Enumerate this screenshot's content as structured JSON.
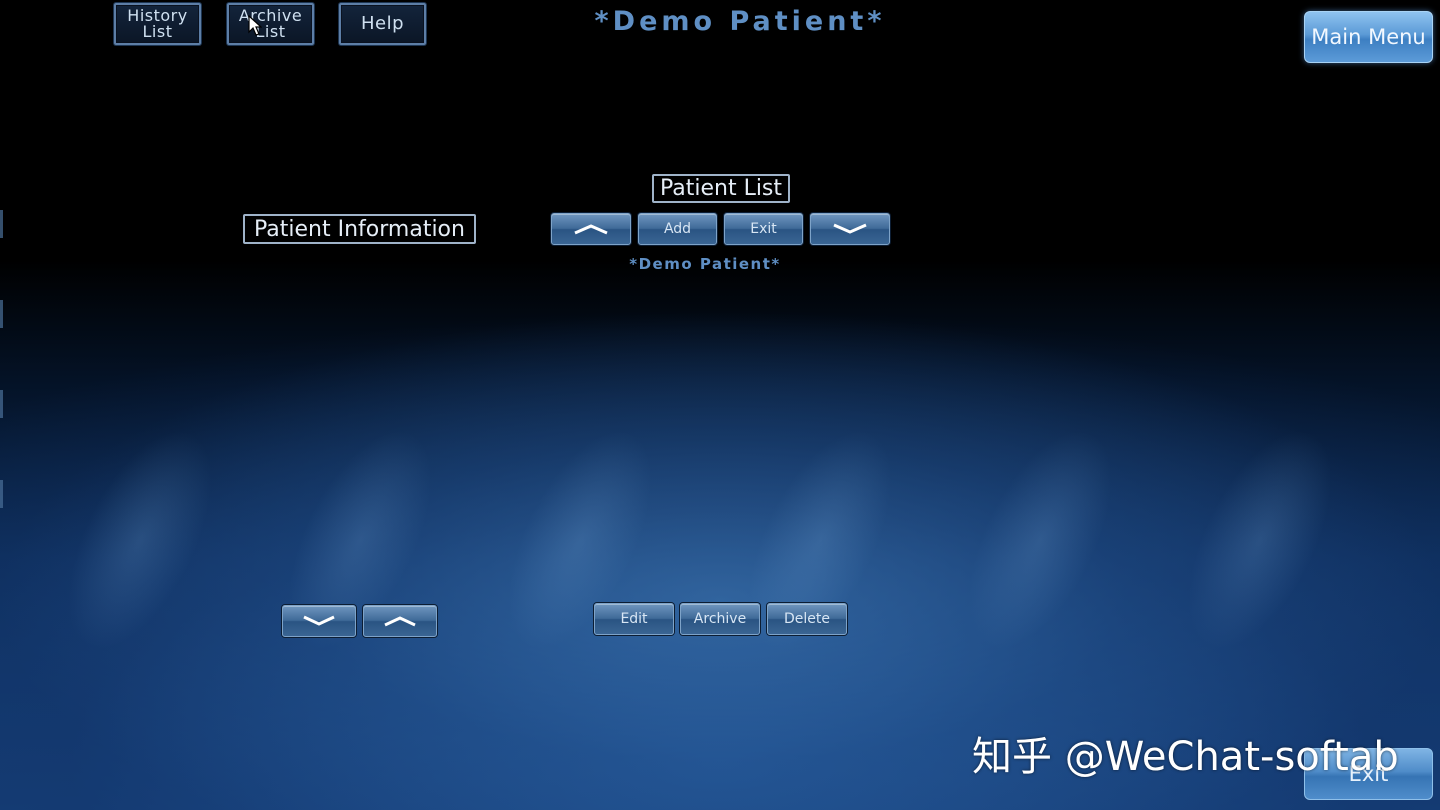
{
  "header": {
    "title": "*Demo Patient*",
    "buttons": {
      "history": "History\nList",
      "archive": "Archive\nList",
      "help": "Help"
    },
    "main_menu": "Main Menu"
  },
  "patient_info": {
    "label": "Patient Information"
  },
  "patient_list": {
    "label": "Patient List",
    "add": "Add",
    "exit": "Exit",
    "selected_patient": "*Demo Patient*"
  },
  "bottom_actions": {
    "edit": "Edit",
    "archive": "Archive",
    "delete": "Delete"
  },
  "footer": {
    "exit": "Exit"
  },
  "watermark": {
    "text": "知乎 @WeChat-softab"
  },
  "icons": {
    "up": "chevron-up-icon",
    "down": "chevron-down-icon",
    "cursor": "mouse-pointer-icon"
  },
  "colors": {
    "accent_blue": "#5f8fc4",
    "button_blue": "#3f6a98",
    "main_menu_blue": "#5b9ad6"
  }
}
